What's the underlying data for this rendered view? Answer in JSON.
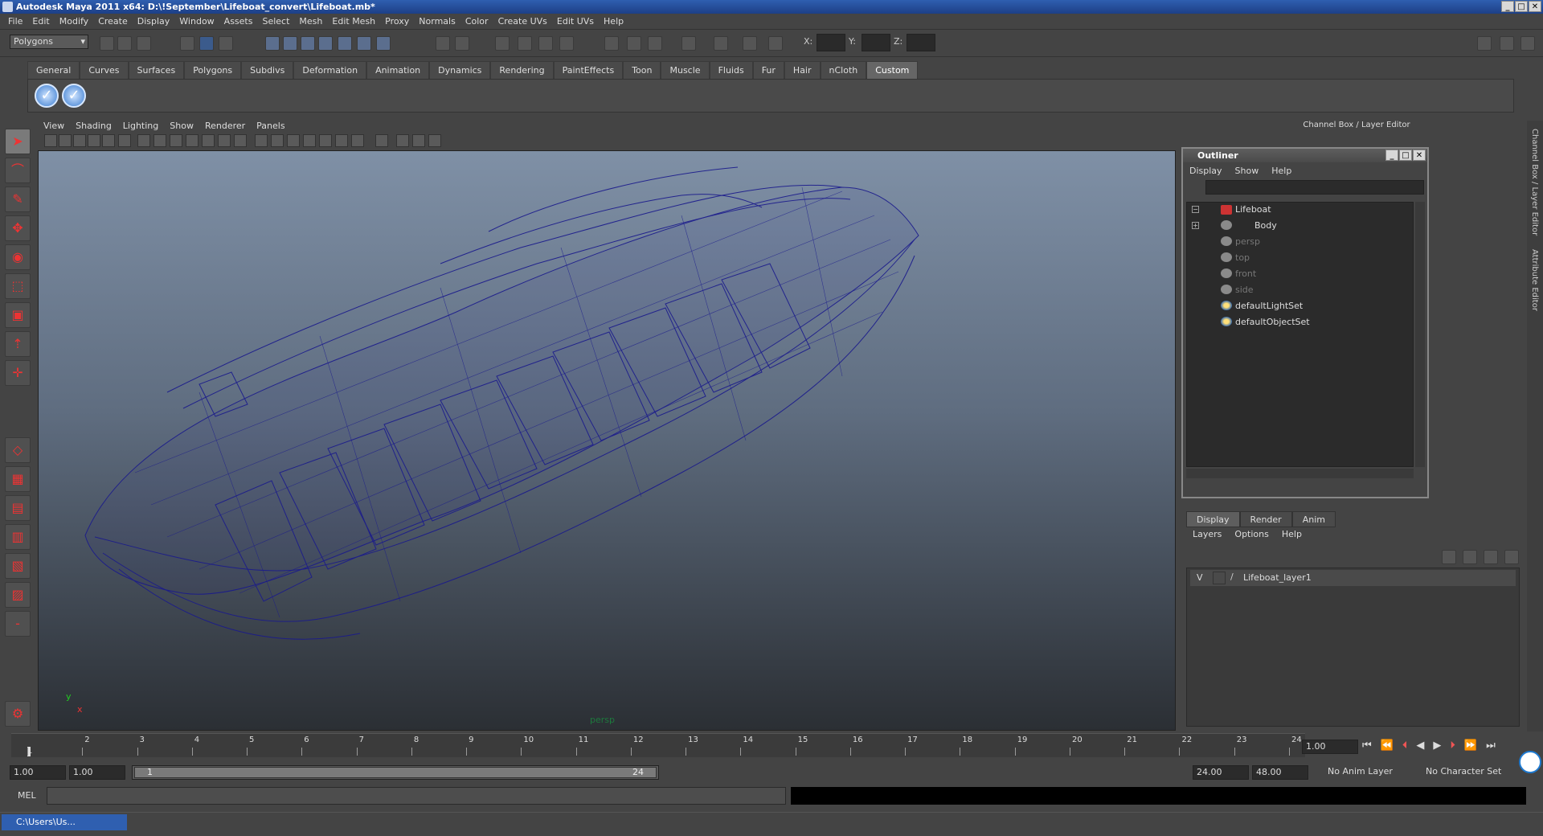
{
  "window": {
    "title": "Autodesk Maya 2011 x64: D:\\!September\\Lifeboat_convert\\Lifeboat.mb*",
    "controls": [
      "_",
      "□",
      "✕"
    ]
  },
  "menubar": [
    "File",
    "Edit",
    "Modify",
    "Create",
    "Display",
    "Window",
    "Assets",
    "Select",
    "Mesh",
    "Edit Mesh",
    "Proxy",
    "Normals",
    "Color",
    "Create UVs",
    "Edit UVs",
    "Help"
  ],
  "statusline": {
    "mode": "Polygons",
    "coords": [
      "X:",
      "Y:",
      "Z:"
    ]
  },
  "shelf": {
    "tabs": [
      "General",
      "Curves",
      "Surfaces",
      "Polygons",
      "Subdivs",
      "Deformation",
      "Animation",
      "Dynamics",
      "Rendering",
      "PaintEffects",
      "Toon",
      "Muscle",
      "Fluids",
      "Fur",
      "Hair",
      "nCloth",
      "Custom"
    ],
    "active_tab": "Custom"
  },
  "viewport": {
    "menu": [
      "View",
      "Shading",
      "Lighting",
      "Show",
      "Renderer",
      "Panels"
    ],
    "camera_label": "persp",
    "axis": {
      "y": "y",
      "x": "x"
    },
    "wire_color": "#1a1a8c"
  },
  "channel_box": {
    "title": "Channel Box / Layer Editor",
    "side_tabs": [
      "Channel Box / Layer Editor",
      "Attribute Editor"
    ]
  },
  "outliner": {
    "title": "Outliner",
    "menu": [
      "Display",
      "Show",
      "Help"
    ],
    "items": [
      {
        "label": "Lifeboat",
        "dim": false
      },
      {
        "label": "Body",
        "dim": false
      },
      {
        "label": "persp",
        "dim": true
      },
      {
        "label": "top",
        "dim": true
      },
      {
        "label": "front",
        "dim": true
      },
      {
        "label": "side",
        "dim": true
      },
      {
        "label": "defaultLightSet",
        "dim": false
      },
      {
        "label": "defaultObjectSet",
        "dim": false
      }
    ]
  },
  "layer_editor": {
    "tabs": [
      "Display",
      "Render",
      "Anim"
    ],
    "active_tab": "Display",
    "menu": [
      "Layers",
      "Options",
      "Help"
    ],
    "layer": {
      "visible": "V",
      "name": "Lifeboat_layer1"
    }
  },
  "time_slider": {
    "ticks": [
      "1",
      "2",
      "3",
      "4",
      "5",
      "6",
      "7",
      "8",
      "9",
      "10",
      "11",
      "12",
      "13",
      "14",
      "15",
      "16",
      "17",
      "18",
      "19",
      "20",
      "21",
      "22",
      "23",
      "24"
    ],
    "current_frame_marker": "1",
    "current_frame": "1.00"
  },
  "range_slider": {
    "start": "1.00",
    "playback_start": "1.00",
    "range_start": "1",
    "range_end": "24",
    "playback_end": "24.00",
    "end": "48.00",
    "anim_layer": "No Anim Layer",
    "character_set": "No Character Set"
  },
  "command_line": {
    "label": "MEL"
  },
  "taskbar": {
    "item": "C:\\Users\\Us..."
  }
}
